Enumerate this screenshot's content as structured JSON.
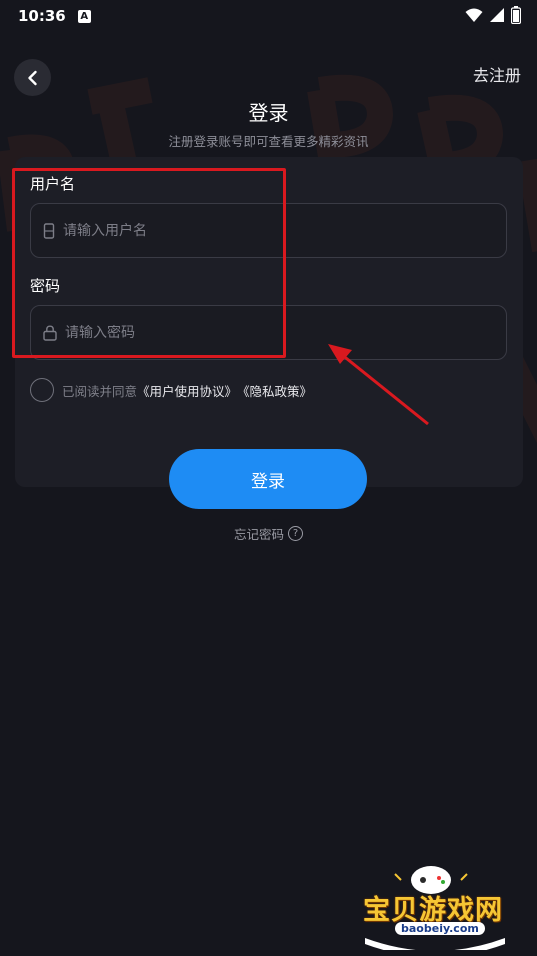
{
  "status_bar": {
    "time": "10:36",
    "notification_badge": "A"
  },
  "header": {
    "register_label": "去注册"
  },
  "title": "登录",
  "subtitle": "注册登录账号即可查看更多精彩资讯",
  "form": {
    "username": {
      "label": "用户名",
      "placeholder": "请输入用户名",
      "value": ""
    },
    "password": {
      "label": "密码",
      "placeholder": "请输入密码",
      "value": ""
    },
    "agreement": {
      "prefix": "已阅读并同意",
      "user_agreement": "《用户使用协议》",
      "privacy_policy": "《隐私政策》",
      "checked": false
    },
    "login_label": "登录",
    "forgot_label": "忘记密码"
  },
  "watermark": {
    "site_name": "宝贝游戏网",
    "site_url": "baobeiy.com"
  },
  "colors": {
    "background": "#15161d",
    "card": "#1d1e26",
    "accent": "#1e8cf4",
    "annotation": "#d9191f"
  }
}
